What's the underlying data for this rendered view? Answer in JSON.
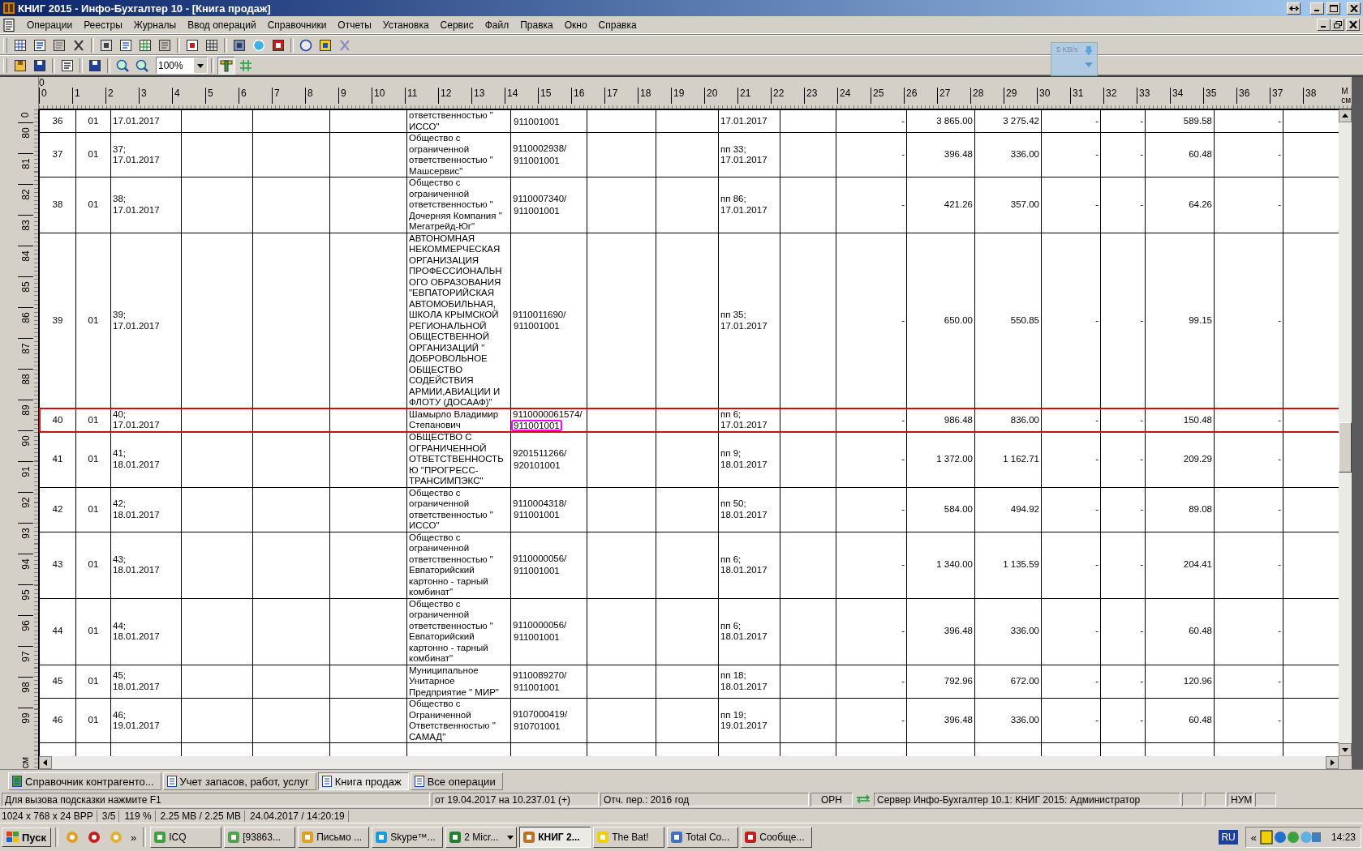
{
  "window": {
    "title": "КНИГ 2015 - Инфо-Бухгалтер 10 - [Книга продаж]"
  },
  "menu": [
    "Операции",
    "Реестры",
    "Журналы",
    "Ввод операций",
    "Справочники",
    "Отчеты",
    "Установка",
    "Сервис",
    "Файл",
    "Правка",
    "Окно",
    "Справка"
  ],
  "zoom": {
    "value": "100%"
  },
  "net_meter": {
    "reading": "5 KB/s"
  },
  "ruler": {
    "top_origin": "0",
    "top_marks": [
      "0",
      "1",
      "2",
      "3",
      "4",
      "5",
      "6",
      "7",
      "8",
      "9",
      "10",
      "11",
      "12",
      "13",
      "14",
      "15",
      "16",
      "17",
      "18",
      "19",
      "20",
      "21",
      "22",
      "23",
      "24",
      "25",
      "26",
      "27",
      "28",
      "29",
      "30",
      "31",
      "32",
      "33",
      "34",
      "35",
      "36",
      "37",
      "38"
    ],
    "top_unit_upper": "М",
    "top_unit": "см",
    "side_origin": "0",
    "side_marks": [
      "80",
      "81",
      "82",
      "83",
      "84",
      "85",
      "86",
      "87",
      "88",
      "89",
      "90",
      "91",
      "92",
      "93",
      "94",
      "95",
      "96",
      "97",
      "98",
      "99"
    ],
    "side_unit": "см"
  },
  "rows": [
    {
      "no": "36",
      "code": "01",
      "invoice": "17.01.2017",
      "name": "ответственностью \"\nИССО\"",
      "kpp": "911001001",
      "payment": "17.01.2017",
      "col_12": "-",
      "total": "3 865.00",
      "base": "3 275.42",
      "col_15": "-",
      "col_16": "-",
      "vat": "589.58",
      "col_18": "-",
      "selected": false,
      "kpp_marked": false
    },
    {
      "no": "37",
      "code": "01",
      "invoice": "37;\n17.01.2017",
      "name": "Общество с\nограниченной\nответственностью \"\nМашсервис\"",
      "inn": "9110002938/",
      "kpp": "911001001",
      "payment": "пп 33;\n17.01.2017",
      "col_12": "-",
      "total": "396.48",
      "base": "336.00",
      "col_15": "-",
      "col_16": "-",
      "vat": "60.48",
      "col_18": "-",
      "selected": false,
      "kpp_marked": false
    },
    {
      "no": "38",
      "code": "01",
      "invoice": "38;\n17.01.2017",
      "name": "Общество с\nограниченной\nответственностью \"\nДочерняя Компания  \"\nМегатрейд-Юг\"",
      "inn": "9110007340/",
      "kpp": "911001001",
      "payment": "пп 86;\n17.01.2017",
      "col_12": "-",
      "total": "421.26",
      "base": "357.00",
      "col_15": "-",
      "col_16": "-",
      "vat": "64.26",
      "col_18": "-",
      "selected": false,
      "kpp_marked": false
    },
    {
      "no": "39",
      "code": "01",
      "invoice": "39;\n17.01.2017",
      "name": "АВТОНОМНАЯ\nНЕКОММЕРЧЕСКАЯ\nОРГАНИЗАЦИЯ\nПРОФЕССИОНАЛЬН\nОГО ОБРАЗОВАНИЯ\n\"ЕВПАТОРИЙСКАЯ\nАВТОМОБИЛЬНАЯ,\nШКОЛА КРЫМСКОЙ\nРЕГИОНАЛЬНОЙ\nОБЩЕСТВЕННОЙ\nОРГАНИЗАЦИЙ \"\nДОБРОВОЛЬНОЕ\nОБЩЕСТВО\nСОДЕЙСТВИЯ\nАРМИИ,АВИАЦИИ И\nФЛОТУ (ДОСААФ)\"",
      "inn": "9110011690/",
      "kpp": "911001001",
      "payment": "пп 35;\n17.01.2017",
      "col_12": "-",
      "total": "650.00",
      "base": "550.85",
      "col_15": "-",
      "col_16": "-",
      "vat": "99.15",
      "col_18": "-",
      "selected": false,
      "kpp_marked": false
    },
    {
      "no": "40",
      "code": "01",
      "invoice": "40;\n17.01.2017",
      "name": "Шамырло Владимир\nСтепанович",
      "inn": "9110000061574/",
      "kpp": "911001001",
      "payment": "пп 6;\n17.01.2017",
      "col_12": "-",
      "total": "986.48",
      "base": "836.00",
      "col_15": "-",
      "col_16": "-",
      "vat": "150.48",
      "col_18": "-",
      "selected": true,
      "kpp_marked": true
    },
    {
      "no": "41",
      "code": "01",
      "invoice": "41;\n18.01.2017",
      "name": "ОБЩЕСТВО С\nОГРАНИЧЕННОЙ\nОТВЕТСТВЕННОСТЬ\nЮ \"ПРОГРЕСС-\nТРАНСИМПЭКС\"",
      "inn": "9201511266/",
      "kpp": "920101001",
      "payment": "пп 9;\n18.01.2017",
      "col_12": "-",
      "total": "1 372.00",
      "base": "1 162.71",
      "col_15": "-",
      "col_16": "-",
      "vat": "209.29",
      "col_18": "-",
      "selected": false,
      "kpp_marked": false
    },
    {
      "no": "42",
      "code": "01",
      "invoice": "42;\n18.01.2017",
      "name": "Общество с\nограниченной\nответственностью \"\nИССО\"",
      "inn": "9110004318/",
      "kpp": "911001001",
      "payment": "пп 50;\n18.01.2017",
      "col_12": "-",
      "total": "584.00",
      "base": "494.92",
      "col_15": "-",
      "col_16": "-",
      "vat": "89.08",
      "col_18": "-",
      "selected": false,
      "kpp_marked": false
    },
    {
      "no": "43",
      "code": "01",
      "invoice": "43;\n18.01.2017",
      "name": "Общество с\nограниченной\nответственностью \"\nЕвпаторийский\nкартонно - тарный\nкомбинат\"",
      "inn": "9110000056/",
      "kpp": "911001001",
      "payment": "пп 6;\n18.01.2017",
      "col_12": "-",
      "total": "1 340.00",
      "base": "1 135.59",
      "col_15": "-",
      "col_16": "-",
      "vat": "204.41",
      "col_18": "-",
      "selected": false,
      "kpp_marked": false
    },
    {
      "no": "44",
      "code": "01",
      "invoice": "44;\n18.01.2017",
      "name": "Общество с\nограниченной\nответственностью \"\nЕвпаторийский\nкартонно - тарный\nкомбинат\"",
      "inn": "9110000056/",
      "kpp": "911001001",
      "payment": "пп 6;\n18.01.2017",
      "col_12": "-",
      "total": "396.48",
      "base": "336.00",
      "col_15": "-",
      "col_16": "-",
      "vat": "60.48",
      "col_18": "-",
      "selected": false,
      "kpp_marked": false
    },
    {
      "no": "45",
      "code": "01",
      "invoice": "45;\n18.01.2017",
      "name": "Муниципальное\nУнитарное\nПредприятие \" МИР\"",
      "inn": "9110089270/",
      "kpp": "911001001",
      "payment": "пп 18;\n18.01.2017",
      "col_12": "-",
      "total": "792.96",
      "base": "672.00",
      "col_15": "-",
      "col_16": "-",
      "vat": "120.96",
      "col_18": "-",
      "selected": false,
      "kpp_marked": false
    },
    {
      "no": "46",
      "code": "01",
      "invoice": "46;\n19.01.2017",
      "name": "Общество с\nОграниченной\nОтветственностью \"\nСАМАД\"",
      "inn": "9107000419/",
      "kpp": "910701001",
      "payment": "пп 19;\n19.01.2017",
      "col_12": "-",
      "total": "396.48",
      "base": "336.00",
      "col_15": "-",
      "col_16": "-",
      "vat": "60.48",
      "col_18": "-",
      "selected": false,
      "kpp_marked": false
    }
  ],
  "tabs": [
    {
      "label": "Справочник контрагенто...",
      "selected": false
    },
    {
      "label": "Учет запасов, работ, услуг",
      "selected": false
    },
    {
      "label": "Книга продаж",
      "selected": true
    },
    {
      "label": "Все операции",
      "selected": false
    }
  ],
  "status_bar": {
    "hint": "Для вызова подсказки нажмите F1",
    "version": "от 19.04.2017 на 10.237.01 (+)",
    "period": "Отч. пер.: 2016 год",
    "mode": "ОРН",
    "server": "Сервер Инфо-Бухгалтер 10.1: КНИГ 2015: Администратор",
    "num": "НУМ"
  },
  "system_info": [
    "1024 x 768 x 24 BPP",
    "3/5",
    "119 %",
    "2.25 MB / 2.25 MB",
    "24.04.2017 / 14:20:19"
  ],
  "taskbar": {
    "start": "Пуск",
    "more": "»",
    "tasks": [
      {
        "label": "ICQ",
        "selected": false
      },
      {
        "label": "[93863...",
        "selected": false
      },
      {
        "label": "Письмо ...",
        "selected": false
      },
      {
        "label": "Skype™...",
        "selected": false
      },
      {
        "label": "2 Micr...",
        "selected": false
      },
      {
        "label": "КНИГ 2...",
        "selected": true
      },
      {
        "label": "The Bat!",
        "selected": false
      },
      {
        "label": "Total Co...",
        "selected": false
      },
      {
        "label": "Сообще...",
        "selected": false
      }
    ],
    "language": "RU",
    "tray_expand": "«",
    "clock": "14:23"
  }
}
